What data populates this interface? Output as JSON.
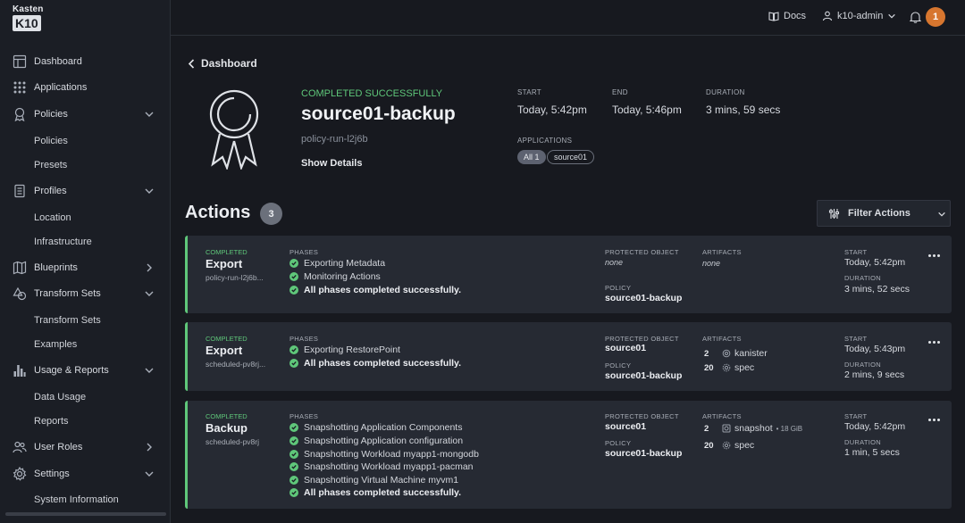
{
  "brand": {
    "line1": "Kasten",
    "line2": "K10"
  },
  "topbar": {
    "docs_label": "Docs",
    "user_label": "k10-admin",
    "notification_count": "1"
  },
  "sidebar": {
    "items": [
      {
        "label": "Dashboard"
      },
      {
        "label": "Applications"
      },
      {
        "label": "Policies",
        "children": [
          "Policies",
          "Presets"
        ]
      },
      {
        "label": "Profiles",
        "children": [
          "Location",
          "Infrastructure"
        ]
      },
      {
        "label": "Blueprints"
      },
      {
        "label": "Transform Sets",
        "children": [
          "Transform Sets",
          "Examples"
        ]
      },
      {
        "label": "Usage & Reports",
        "children": [
          "Data Usage",
          "Reports"
        ]
      },
      {
        "label": "User Roles"
      },
      {
        "label": "Settings",
        "children": [
          "System Information"
        ]
      }
    ]
  },
  "header": {
    "back_label": "Dashboard",
    "status": "COMPLETED SUCCESSFULLY",
    "title": "source01-backup",
    "subtitle": "policy-run-l2j6b",
    "show_details": "Show Details",
    "start_label": "START",
    "start_value": "Today, 5:42pm",
    "end_label": "END",
    "end_value": "Today, 5:46pm",
    "duration_label": "DURATION",
    "duration_value": "3 mins, 59 secs",
    "applications_label": "APPLICATIONS",
    "app_chips": [
      "All 1",
      "source01"
    ]
  },
  "actions": {
    "title": "Actions",
    "count": "3",
    "filter_label": "Filter Actions",
    "labels": {
      "phases": "PHASES",
      "protected_object": "PROTECTED OBJECT",
      "artifacts": "ARTIFACTS",
      "start": "START",
      "duration": "DURATION",
      "policy": "POLICY"
    },
    "cards": [
      {
        "status": "COMPLETED",
        "type": "Export",
        "sub": "policy-run-l2j6b...",
        "phases": [
          "Exporting Metadata",
          "Monitoring Actions",
          "All phases completed successfully."
        ],
        "protected_object": "none",
        "policy": "source01-backup",
        "artifacts_none": "none",
        "start": "Today, 5:42pm",
        "duration": "3 mins, 52 secs"
      },
      {
        "status": "COMPLETED",
        "type": "Export",
        "sub": "scheduled-pv8rj...",
        "phases": [
          "Exporting RestorePoint",
          "All phases completed successfully."
        ],
        "protected_object": "source01",
        "policy": "source01-backup",
        "artifacts": [
          {
            "count": "2",
            "name": "kanister"
          },
          {
            "count": "20",
            "name": "spec"
          }
        ],
        "start": "Today, 5:43pm",
        "duration": "2 mins, 9 secs"
      },
      {
        "status": "COMPLETED",
        "type": "Backup",
        "sub": "scheduled-pv8rj",
        "phases": [
          "Snapshotting Application Components",
          "Snapshotting Application configuration",
          "Snapshotting Workload myapp1-mongodb",
          "Snapshotting Workload myapp1-pacman",
          "Snapshotting Virtual Machine myvm1",
          "All phases completed successfully."
        ],
        "protected_object": "source01",
        "policy": "source01-backup",
        "artifacts": [
          {
            "count": "2",
            "name": "snapshot",
            "size": "• 18 GiB"
          },
          {
            "count": "20",
            "name": "spec"
          }
        ],
        "start": "Today, 5:42pm",
        "duration": "1 min, 5 secs"
      }
    ]
  }
}
